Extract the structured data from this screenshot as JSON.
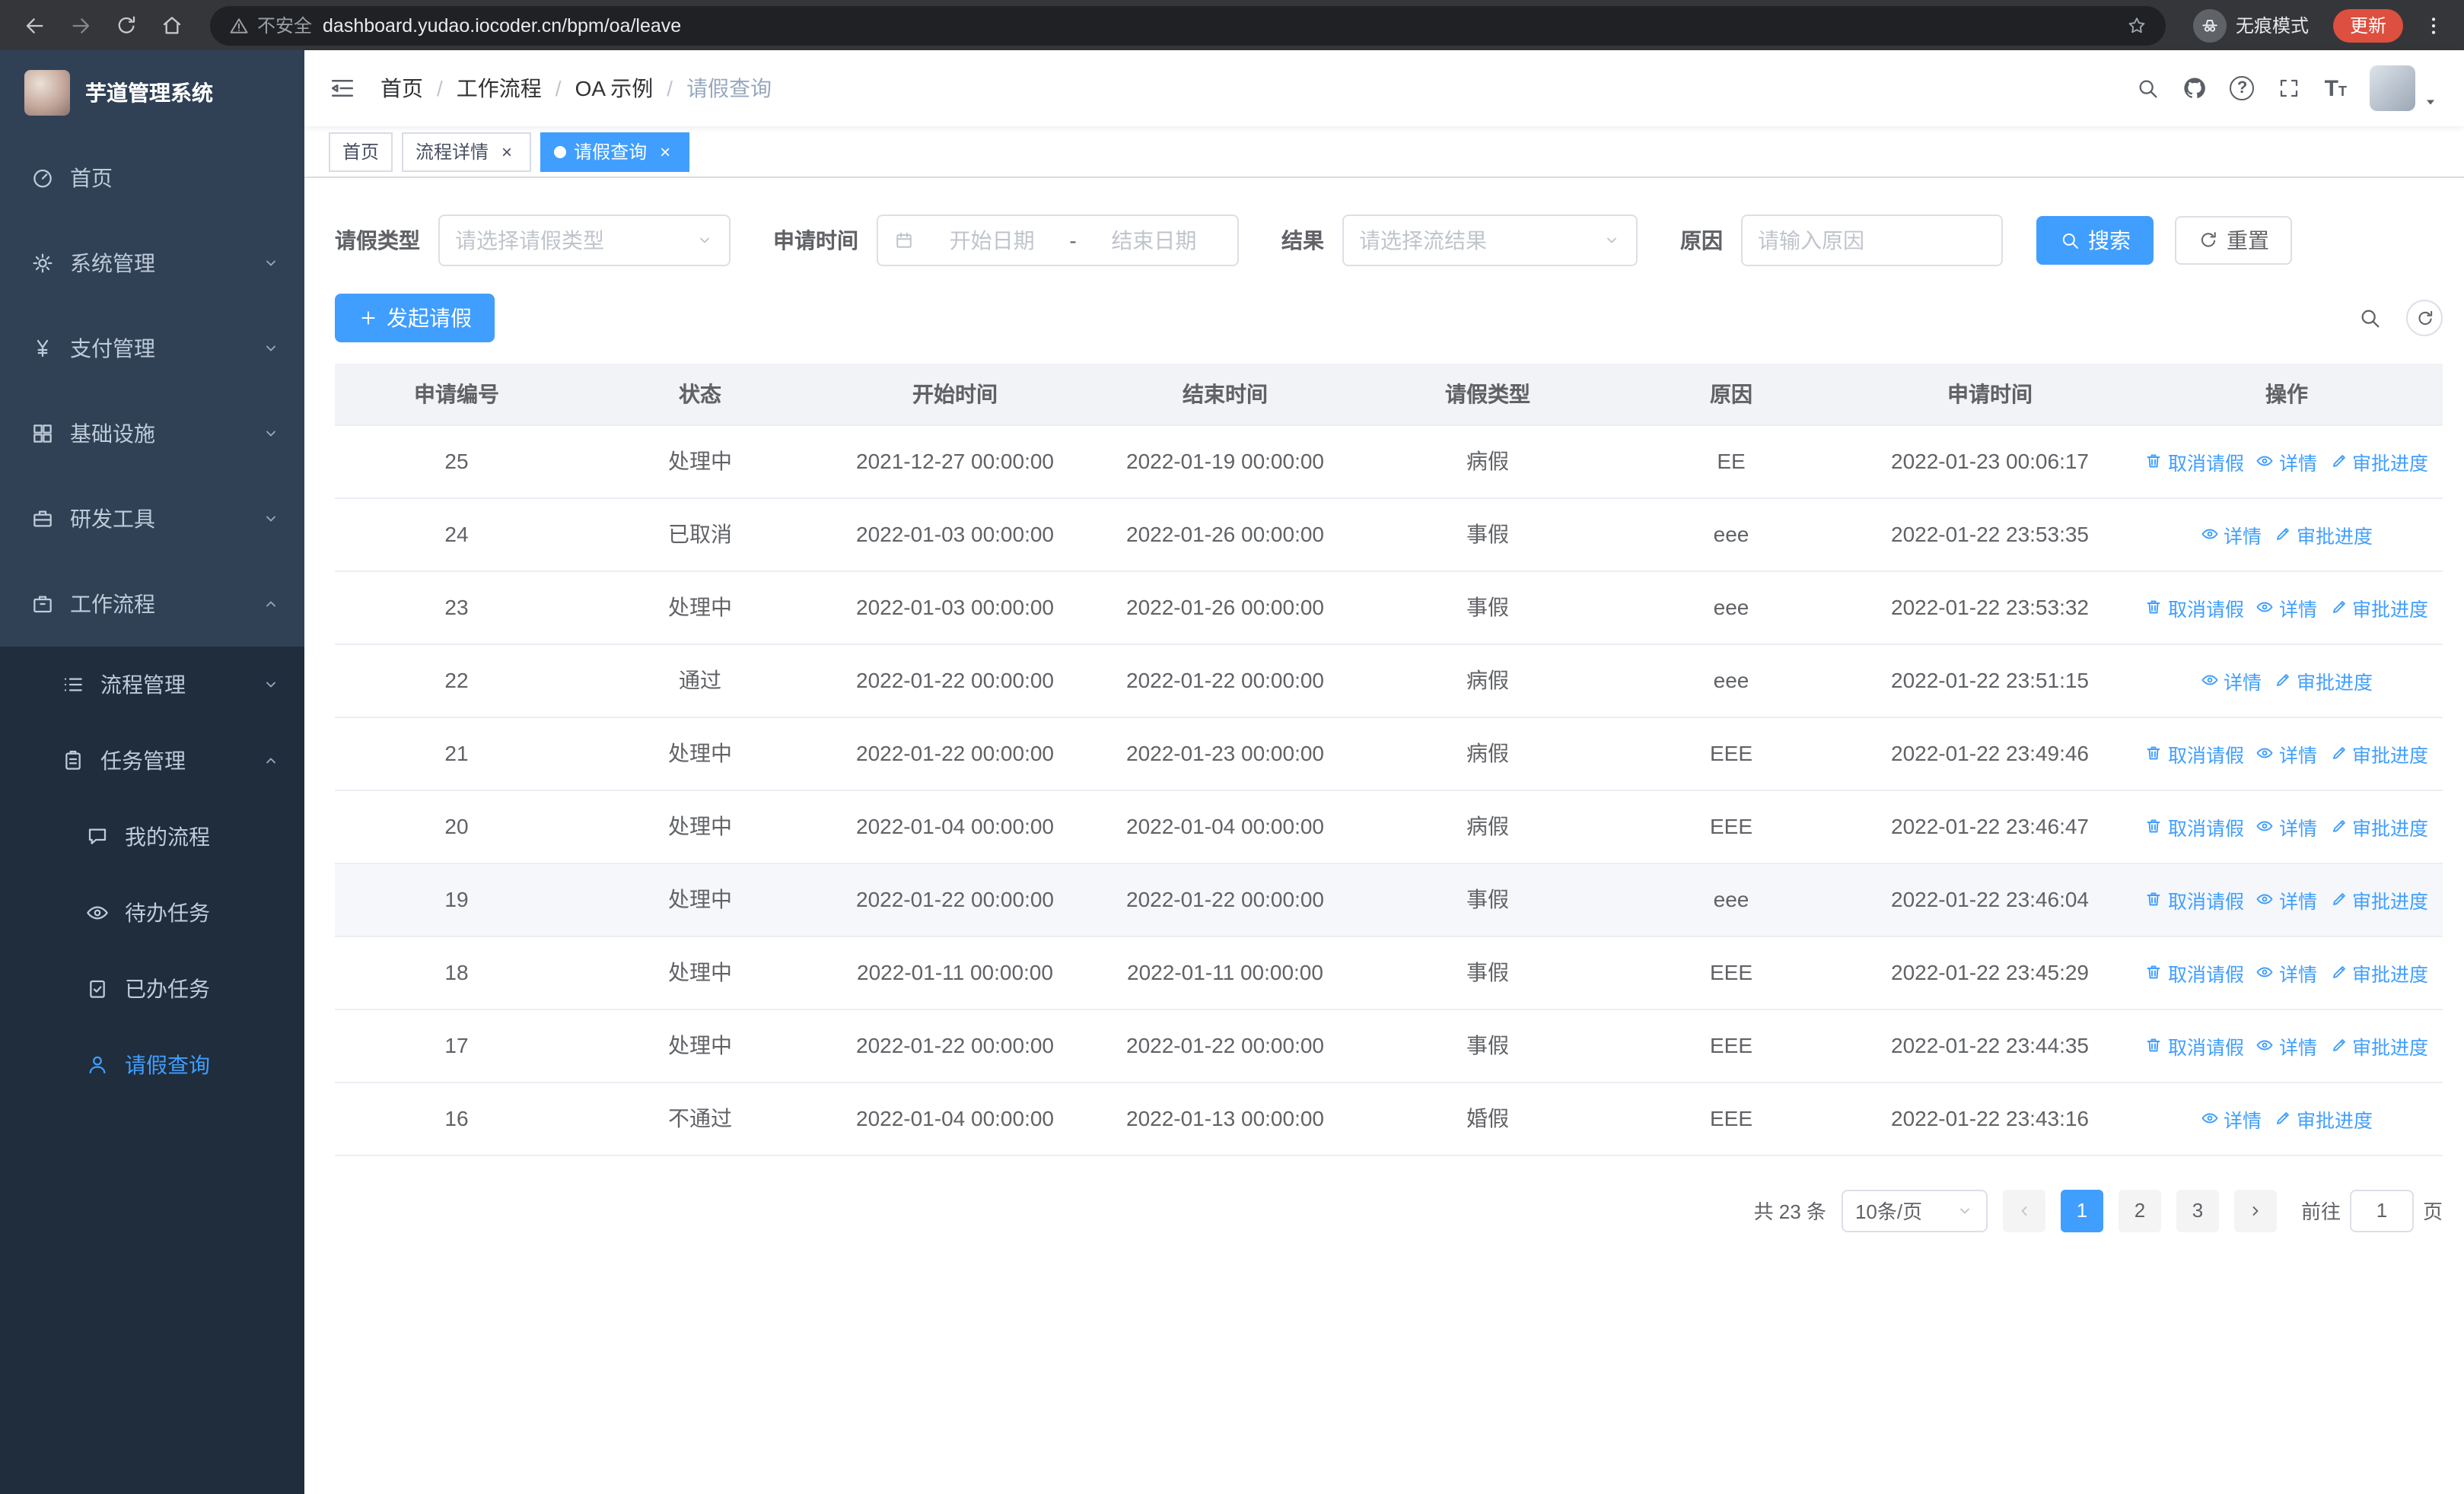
{
  "browser": {
    "security_warning": "不安全",
    "url": "dashboard.yudao.iocoder.cn/bpm/oa/leave",
    "incognito_label": "无痕模式",
    "update_button": "更新"
  },
  "sidebar": {
    "title": "芋道管理系统",
    "root_items": [
      {
        "label": "首页"
      },
      {
        "label": "系统管理"
      },
      {
        "label": "支付管理"
      },
      {
        "label": "基础设施"
      },
      {
        "label": "研发工具"
      },
      {
        "label": "工作流程"
      }
    ],
    "workflow_items": [
      {
        "label": "流程管理"
      },
      {
        "label": "任务管理"
      }
    ],
    "task_items": [
      {
        "label": "我的流程"
      },
      {
        "label": "待办任务"
      },
      {
        "label": "已办任务"
      },
      {
        "label": "请假查询"
      }
    ]
  },
  "header": {
    "breadcrumb": [
      "首页",
      "工作流程",
      "OA 示例",
      "请假查询"
    ]
  },
  "tabs": [
    {
      "label": "首页"
    },
    {
      "label": "流程详情"
    },
    {
      "label": "请假查询"
    }
  ],
  "filters": {
    "leave_type_label": "请假类型",
    "leave_type_placeholder": "请选择请假类型",
    "apply_time_label": "申请时间",
    "start_date_placeholder": "开始日期",
    "date_separator": "-",
    "end_date_placeholder": "结束日期",
    "result_label": "结果",
    "result_placeholder": "请选择流结果",
    "reason_label": "原因",
    "reason_placeholder": "请输入原因",
    "search_button": "搜索",
    "reset_button": "重置"
  },
  "toolbar": {
    "create_button": "发起请假"
  },
  "table": {
    "columns": [
      "申请编号",
      "状态",
      "开始时间",
      "结束时间",
      "请假类型",
      "原因",
      "申请时间",
      "操作"
    ],
    "action_labels": {
      "cancel": "取消请假",
      "detail": "详情",
      "progress": "审批进度"
    },
    "rows": [
      {
        "no": "25",
        "status": "处理中",
        "start": "2021-12-27 00:00:00",
        "end": "2022-01-19 00:00:00",
        "type": "病假",
        "reason": "EE",
        "applied": "2022-01-23 00:06:17",
        "cancel": true,
        "highlighted": false
      },
      {
        "no": "24",
        "status": "已取消",
        "start": "2022-01-03 00:00:00",
        "end": "2022-01-26 00:00:00",
        "type": "事假",
        "reason": "eee",
        "applied": "2022-01-22 23:53:35",
        "cancel": false,
        "highlighted": false
      },
      {
        "no": "23",
        "status": "处理中",
        "start": "2022-01-03 00:00:00",
        "end": "2022-01-26 00:00:00",
        "type": "事假",
        "reason": "eee",
        "applied": "2022-01-22 23:53:32",
        "cancel": true,
        "highlighted": false
      },
      {
        "no": "22",
        "status": "通过",
        "start": "2022-01-22 00:00:00",
        "end": "2022-01-22 00:00:00",
        "type": "病假",
        "reason": "eee",
        "applied": "2022-01-22 23:51:15",
        "cancel": false,
        "highlighted": false
      },
      {
        "no": "21",
        "status": "处理中",
        "start": "2022-01-22 00:00:00",
        "end": "2022-01-23 00:00:00",
        "type": "病假",
        "reason": "EEE",
        "applied": "2022-01-22 23:49:46",
        "cancel": true,
        "highlighted": false
      },
      {
        "no": "20",
        "status": "处理中",
        "start": "2022-01-04 00:00:00",
        "end": "2022-01-04 00:00:00",
        "type": "病假",
        "reason": "EEE",
        "applied": "2022-01-22 23:46:47",
        "cancel": true,
        "highlighted": false
      },
      {
        "no": "19",
        "status": "处理中",
        "start": "2022-01-22 00:00:00",
        "end": "2022-01-22 00:00:00",
        "type": "事假",
        "reason": "eee",
        "applied": "2022-01-22 23:46:04",
        "cancel": true,
        "highlighted": true
      },
      {
        "no": "18",
        "status": "处理中",
        "start": "2022-01-11 00:00:00",
        "end": "2022-01-11 00:00:00",
        "type": "事假",
        "reason": "EEE",
        "applied": "2022-01-22 23:45:29",
        "cancel": true,
        "highlighted": false
      },
      {
        "no": "17",
        "status": "处理中",
        "start": "2022-01-22 00:00:00",
        "end": "2022-01-22 00:00:00",
        "type": "事假",
        "reason": "EEE",
        "applied": "2022-01-22 23:44:35",
        "cancel": true,
        "highlighted": false
      },
      {
        "no": "16",
        "status": "不通过",
        "start": "2022-01-04 00:00:00",
        "end": "2022-01-13 00:00:00",
        "type": "婚假",
        "reason": "EEE",
        "applied": "2022-01-22 23:43:16",
        "cancel": false,
        "highlighted": false
      }
    ]
  },
  "pagination": {
    "total": "共 23 条",
    "page_size": "10条/页",
    "pages": [
      "1",
      "2",
      "3"
    ],
    "active_page": "1",
    "goto_label": "前往",
    "goto_value": "1",
    "page_unit": "页"
  },
  "colors": {
    "primary": "#409eff",
    "sidebar_bg": "#304156",
    "submenu_bg": "#1f2d3d"
  }
}
